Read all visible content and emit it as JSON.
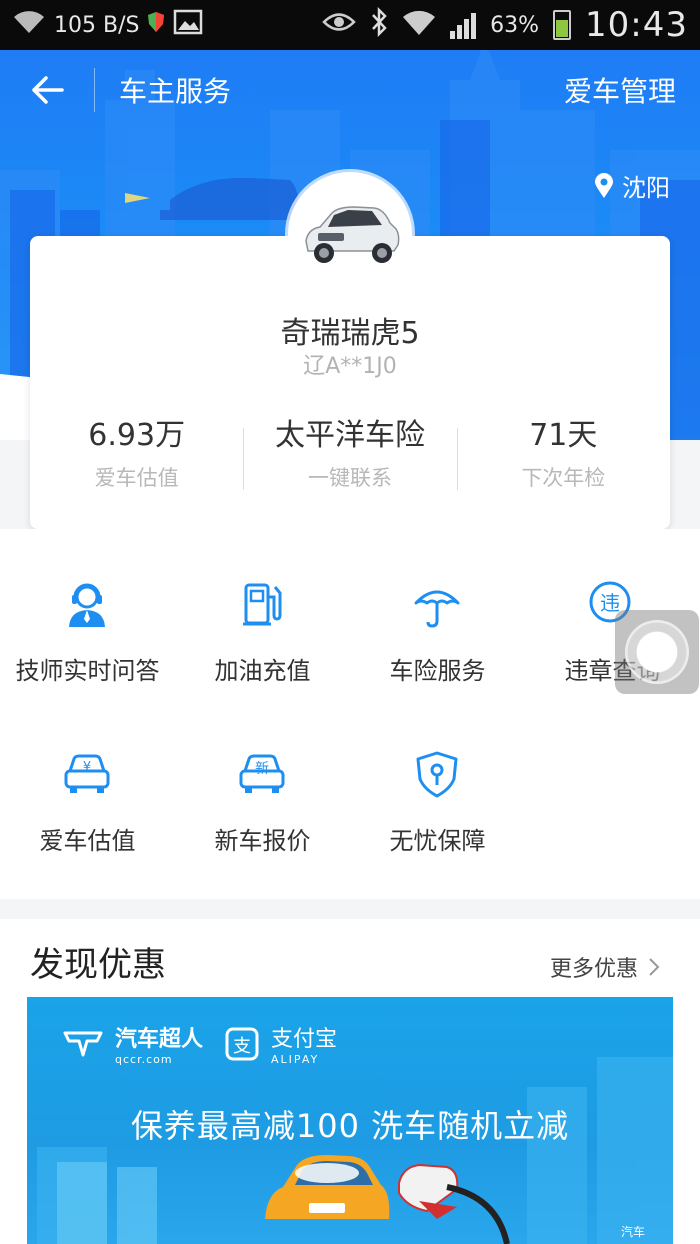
{
  "status_bar": {
    "net_speed": "105 B/S",
    "battery": "63%",
    "time": "10:43"
  },
  "nav": {
    "title": "车主服务",
    "right_action": "爱车管理",
    "city": "沈阳"
  },
  "car": {
    "name": "奇瑞瑞虎5",
    "plate": "辽A**1J0",
    "stats": [
      {
        "value": "6.93万",
        "label": "爱车估值"
      },
      {
        "value": "太平洋车险",
        "label": "一键联系"
      },
      {
        "value": "71天",
        "label": "下次年检"
      }
    ]
  },
  "services": [
    {
      "label": "技师实时问答",
      "icon": "technician-icon"
    },
    {
      "label": "加油充值",
      "icon": "fuel-pump-icon"
    },
    {
      "label": "车险服务",
      "icon": "umbrella-icon"
    },
    {
      "label": "违章查询",
      "icon": "violation-icon"
    },
    {
      "label": "爱车估值",
      "icon": "car-valuation-icon"
    },
    {
      "label": "新车报价",
      "icon": "new-car-icon"
    },
    {
      "label": "无忧保障",
      "icon": "shield-icon"
    }
  ],
  "discover": {
    "title": "发现优惠",
    "more": "更多优惠",
    "banner": {
      "brand1": "汽车超人",
      "brand1_sub": "qccr.com",
      "brand2": "支付宝",
      "brand2_sub": "ALIPAY",
      "promo": "保养最高减100  洗车随机立减",
      "watermark": "汽车"
    }
  },
  "colors": {
    "header_blue": "#1f7cf5",
    "icon_blue": "#1e8ff0",
    "banner_blue": "#1aa3e8"
  }
}
